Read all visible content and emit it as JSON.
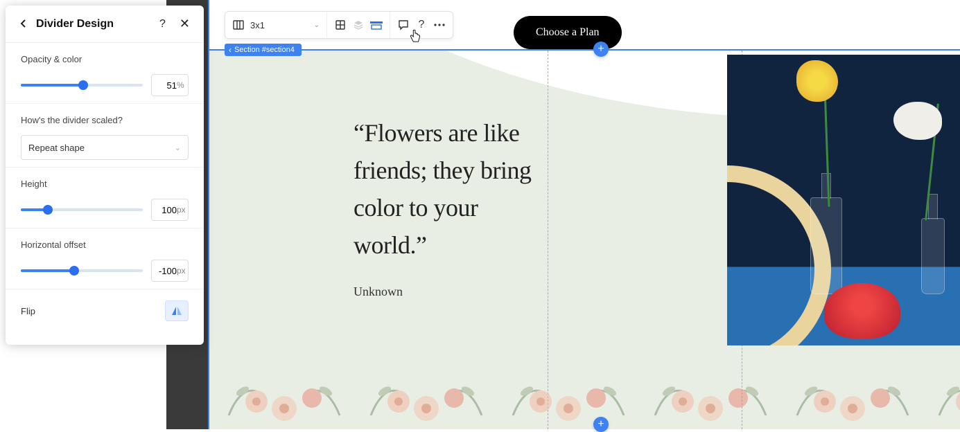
{
  "panel": {
    "title": "Divider Design",
    "opacity_label": "Opacity & color",
    "opacity_value": "51",
    "opacity_unit": "%",
    "scale_label": "How's the divider scaled?",
    "scale_value": "Repeat shape",
    "height_label": "Height",
    "height_value": "100",
    "height_unit": "px",
    "hoffset_label": "Horizontal offset",
    "hoffset_value": "-100",
    "hoffset_unit": "px",
    "flip_label": "Flip"
  },
  "toolbar": {
    "grid_value": "3x1"
  },
  "section_tag": "Section #section4",
  "cta_label": "Choose a Plan",
  "quote_text": "“Flowers are like friends; they bring color to your world.”",
  "quote_author": "Unknown",
  "slider_positions": {
    "opacity_pct": 51,
    "height_pct": 22,
    "hoffset_pct": 44
  }
}
